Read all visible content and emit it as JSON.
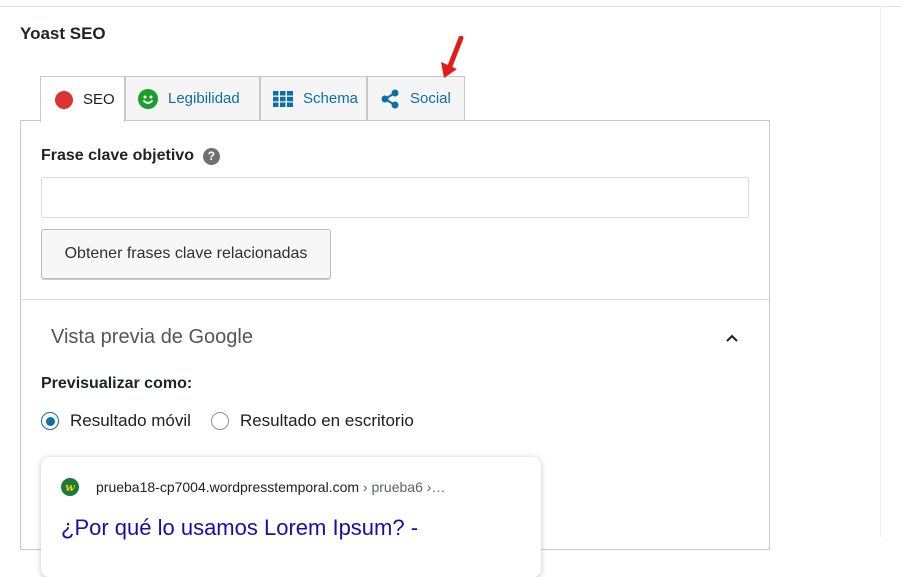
{
  "metabox": {
    "title": "Yoast SEO"
  },
  "tabs": [
    {
      "label": "SEO",
      "icon": "red-dot-icon",
      "active": true
    },
    {
      "label": "Legibilidad",
      "icon": "smiley-icon",
      "active": false
    },
    {
      "label": "Schema",
      "icon": "grid-icon",
      "active": false
    },
    {
      "label": "Social",
      "icon": "share-icon",
      "active": false
    }
  ],
  "keyphrase": {
    "label": "Frase clave objetivo",
    "help": "?",
    "value": "",
    "related_button": "Obtener frases clave relacionadas"
  },
  "google_preview": {
    "title": "Vista previa de Google",
    "preview_as_label": "Previsualizar como:",
    "options": [
      {
        "label": "Resultado móvil",
        "checked": true
      },
      {
        "label": "Resultado en escritorio",
        "checked": false
      }
    ],
    "snippet": {
      "favicon_letter": "w",
      "url": "prueba18-cp7004.wordpresstemporal.com",
      "breadcrumb": " › prueba6 ›…",
      "title": "¿Por qué lo usamos Lorem Ipsum? -"
    }
  },
  "colors": {
    "accent": "#0e6fa8",
    "seo_status": "#dc3232",
    "readability_status": "#1b9e2f",
    "link_title": "#1a0dab",
    "annotation_arrow": "#e31b1b"
  }
}
